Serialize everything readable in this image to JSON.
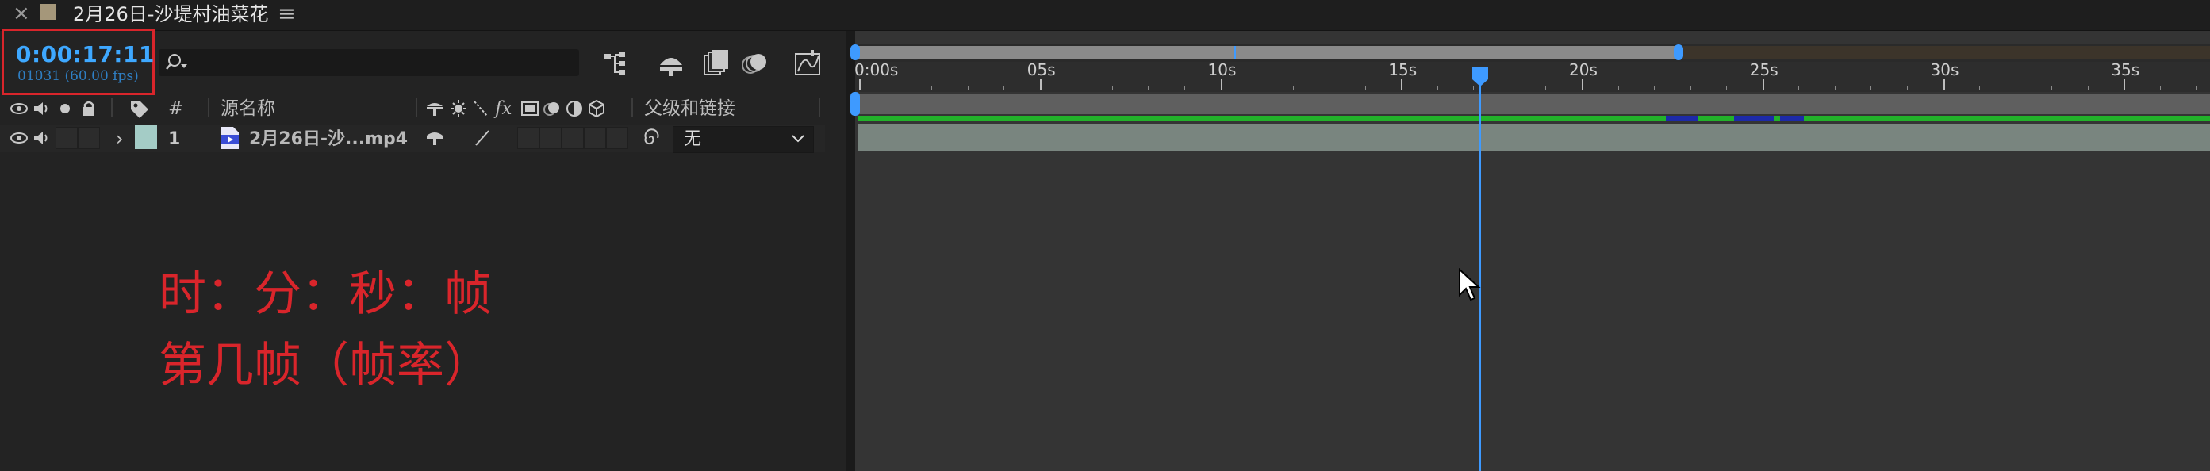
{
  "tab": {
    "title": "2月26日-沙堤村油菜花",
    "close": "×",
    "menu": "≡"
  },
  "timecode": {
    "value": "0:00:17:11",
    "frame_info": "01031 (60.00 fps)"
  },
  "search": {
    "placeholder": ""
  },
  "columns": {
    "hash": "#",
    "source_name": "源名称",
    "parent_link": "父级和链接"
  },
  "layer": {
    "number": "1",
    "name": "2月26日-沙...mp4",
    "label_color": "#a4ccc6",
    "parent": "无"
  },
  "annotation": {
    "line1": "时：分：秒：帧",
    "line2": "第几帧（帧率）"
  },
  "ruler": {
    "labels": [
      "0:00s",
      "05s",
      "10s",
      "15s",
      "20s",
      "25s",
      "30s",
      "35s"
    ]
  },
  "playhead": {
    "time_seconds": 17.18
  },
  "colors": {
    "accent": "#3ea8ff",
    "annotation": "#d9252b",
    "cache": "#22b22a"
  },
  "icons": [
    "close-icon",
    "menu-icon",
    "search-icon",
    "composition-flowchart-icon",
    "draft-3d-icon",
    "frame-blending-icon",
    "motion-blur-icon",
    "graph-editor-icon",
    "eye-icon",
    "speaker-icon",
    "solo-icon",
    "lock-icon",
    "label-icon",
    "video-file-icon",
    "pickwhip-icon",
    "chevron-down-icon",
    "mouse-cursor-icon"
  ]
}
